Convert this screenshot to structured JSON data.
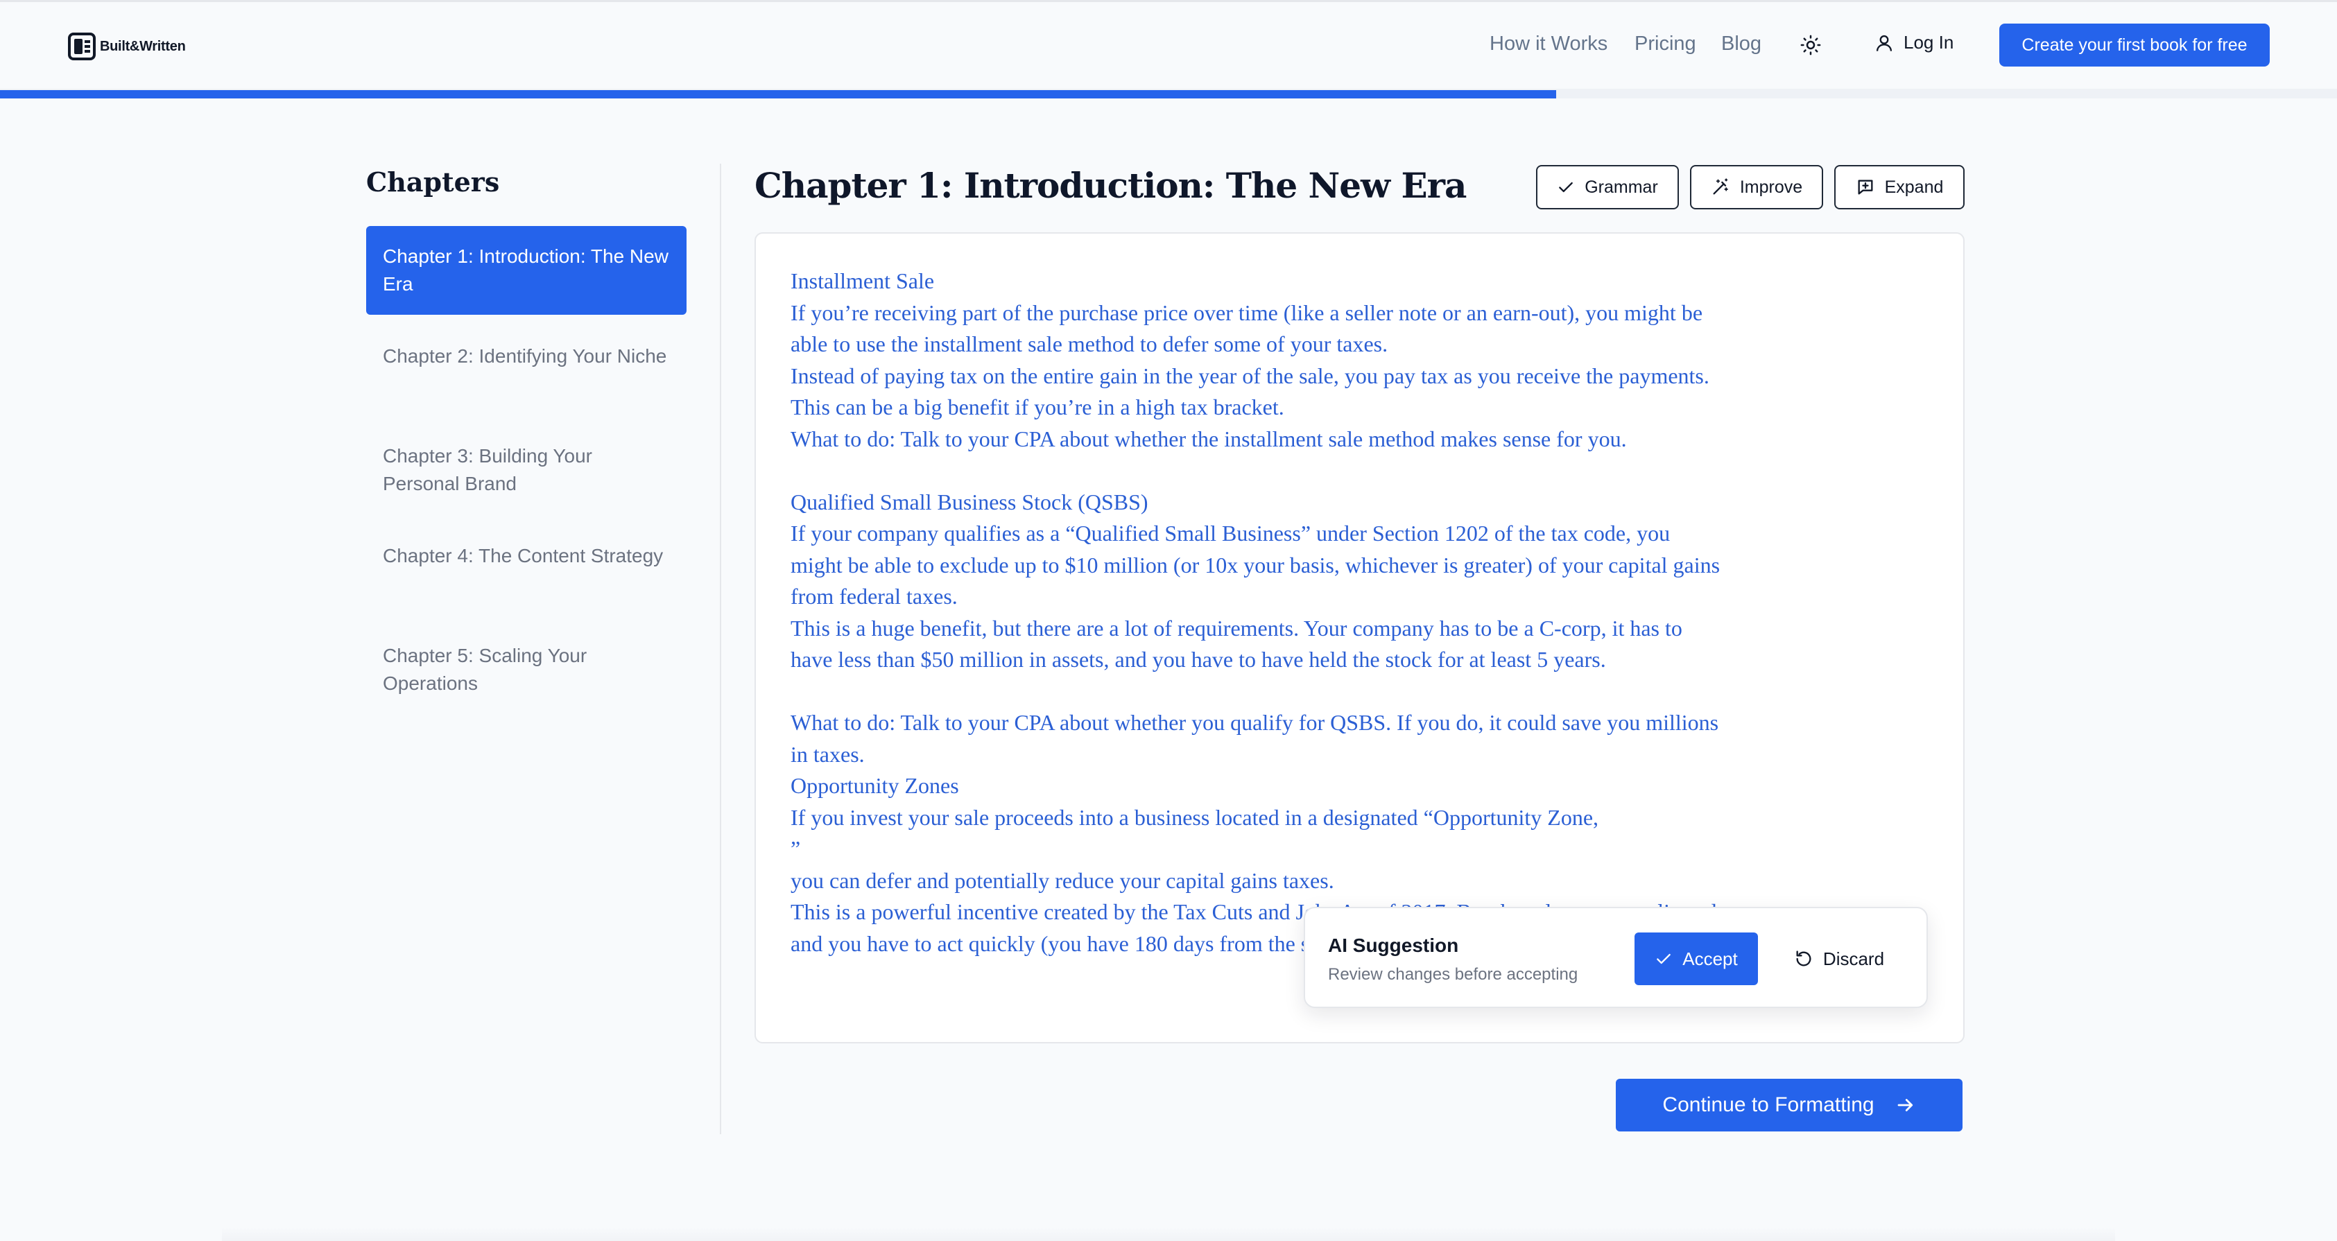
{
  "header": {
    "logo_text": "Built&Written",
    "nav": {
      "how_it_works": "How it Works",
      "pricing": "Pricing",
      "blog": "Blog"
    },
    "login": "Log In",
    "cta": "Create your first book for free"
  },
  "progress": {
    "fraction": 0.666
  },
  "sidebar": {
    "title": "Chapters",
    "chapters": [
      {
        "label": "Chapter 1: Introduction: The New Era",
        "active": true
      },
      {
        "label": "Chapter 2: Identifying Your Niche",
        "active": false
      },
      {
        "label": "Chapter 3: Building Your Personal Brand",
        "active": false
      },
      {
        "label": "Chapter 4: The Content Strategy",
        "active": false
      },
      {
        "label": "Chapter 5: Scaling Your Operations",
        "active": false
      }
    ]
  },
  "main": {
    "heading": "Chapter 1: Introduction: The New Era",
    "tools": {
      "grammar": "Grammar",
      "improve": "Improve",
      "expand": "Expand"
    },
    "editor_paragraphs": [
      "Installment Sale",
      "If you’re receiving part of the purchase price over time (like a seller note or an earn-out), you might be able to use the installment sale method to defer some of your taxes.",
      "Instead of paying tax on the entire gain in the year of the sale, you pay tax as you receive the payments. This can be a big benefit if you’re in a high tax bracket.",
      "What to do: Talk to your CPA about whether the installment sale method makes sense for you.",
      "",
      "Qualified Small Business Stock (QSBS)",
      "If your company qualifies as a “Qualified Small Business” under Section 1202 of the tax code, you might be able to exclude up to $10 million (or 10x your basis, whichever is greater) of your capital gains from federal taxes.",
      "This is a huge benefit, but there are a lot of requirements. Your company has to be a C-corp, it has to have less than $50 million in assets, and you have to have held the stock for at least 5 years.",
      "",
      "What to do: Talk to your CPA about whether you qualify for QSBS. If you do, it could save you millions in taxes.",
      "Opportunity Zones",
      "If you invest your sale proceeds into a business located in a designated “Opportunity Zone,\n”",
      "you can defer and potentially reduce your capital gains taxes.",
      "This is a powerful incentive created by the Tax Cuts and Jobs Act of 2017. But the rules are complicated, and you have to act quickly (you have 180 days from the sale to invest in an Opportunity Zone)."
    ]
  },
  "ai_suggestion": {
    "title": "AI Suggestion",
    "subtitle": "Review changes before accepting",
    "accept": "Accept",
    "discard": "Discard"
  },
  "continue_label": "Continue to Formatting"
}
